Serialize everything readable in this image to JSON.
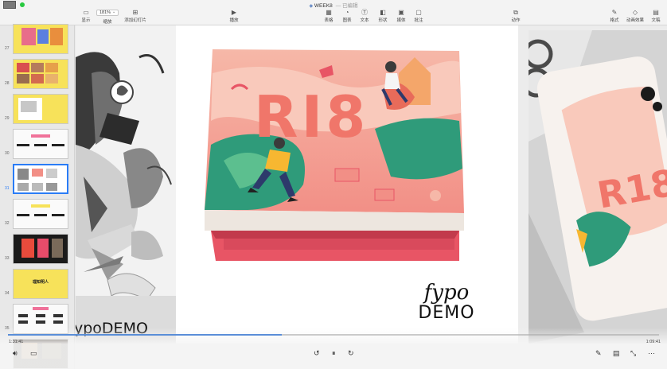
{
  "window": {
    "title": "WEEK8",
    "subtitle": "— 已编辑"
  },
  "toolbar": {
    "view_label": "显示",
    "zoom_value": "181%",
    "zoom_label": "缩放",
    "add_slide_label": "添加幻灯片",
    "play_label": "播放",
    "table_label": "表格",
    "chart_label": "图表",
    "text_label": "文本",
    "shape_label": "形状",
    "media_label": "媒体",
    "comment_label": "批注",
    "animate_label": "动作",
    "format_label": "格式",
    "animate_effect_label": "动画效果",
    "document_label": "文稿"
  },
  "navigator": {
    "selected": "31",
    "slides": [
      {
        "num": "27",
        "theme": "yellow-collage"
      },
      {
        "num": "28",
        "theme": "yellow-gallery"
      },
      {
        "num": "29",
        "theme": "yellow-doc"
      },
      {
        "num": "30",
        "theme": "white-pink-bars"
      },
      {
        "num": "31",
        "theme": "white-photos"
      },
      {
        "num": "32",
        "theme": "white-black-bars"
      },
      {
        "num": "33",
        "theme": "black-posters"
      },
      {
        "num": "34",
        "theme": "yellow-title",
        "title": "理知明人"
      },
      {
        "num": "35",
        "theme": "white-pink-grid"
      }
    ]
  },
  "slide": {
    "brand_script": "fypo",
    "brand_demo": "DEMO",
    "box_lettering": "RI8",
    "left_demo": "ypoDEMO"
  },
  "player": {
    "time_current": "1:31:41",
    "time_total": "1:09:41",
    "progress": 0.42
  },
  "colors": {
    "accent": "#2a7cf6",
    "box_pink": "#f28f86",
    "box_red": "#e85565",
    "progress": "#5a8ed8"
  }
}
